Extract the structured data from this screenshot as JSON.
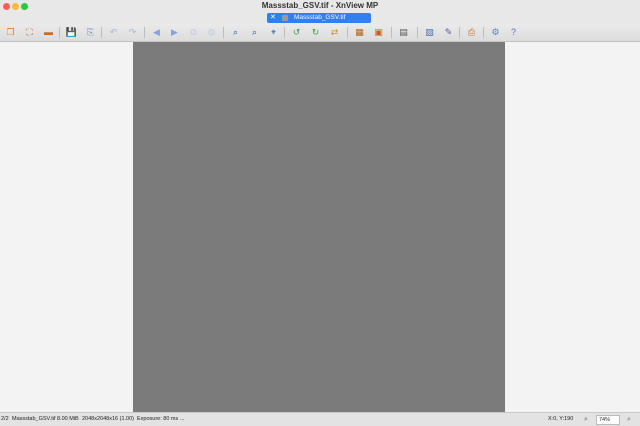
{
  "window": {
    "title": "Massstab_GSV.tif - XnView MP"
  },
  "tab": {
    "label": "Massstab_GSV.tif",
    "close": "✕"
  },
  "toolbar": {
    "buttons": [
      {
        "name": "browser-icon",
        "glyph": "❐",
        "color": "#d08a1e"
      },
      {
        "name": "fullscreen-icon",
        "glyph": "⛶",
        "color": "#d03a1e"
      },
      {
        "name": "slideshow-icon",
        "glyph": "▬",
        "color": "#d06a1e"
      },
      {
        "name": "save-icon",
        "glyph": "💾",
        "color": "#3a6fc0"
      },
      {
        "name": "save-as-icon",
        "glyph": "⎘",
        "color": "#7090b0"
      },
      {
        "name": "undo-icon",
        "glyph": "↶",
        "color": "#a9b3c4"
      },
      {
        "name": "redo-icon",
        "glyph": "↷",
        "color": "#a9b3c4"
      },
      {
        "name": "previous-icon",
        "glyph": "◀",
        "color": "#8aa2d8"
      },
      {
        "name": "next-icon",
        "glyph": "▶",
        "color": "#8aa2d8"
      },
      {
        "name": "first-icon",
        "glyph": "⊙",
        "color": "#b6c1d4"
      },
      {
        "name": "last-icon",
        "glyph": "⊙",
        "color": "#b6c1d4"
      },
      {
        "name": "zoom-in-icon",
        "glyph": "⌕",
        "color": "#2d56a8"
      },
      {
        "name": "zoom-out-icon",
        "glyph": "⌕",
        "color": "#2d56a8"
      },
      {
        "name": "zoom-fit-icon",
        "glyph": "⌖",
        "color": "#2d56a8"
      },
      {
        "name": "rotate-left-icon",
        "glyph": "↺",
        "color": "#3aa043"
      },
      {
        "name": "rotate-right-icon",
        "glyph": "↻",
        "color": "#3aa043"
      },
      {
        "name": "flip-icon",
        "glyph": "⇄",
        "color": "#c79a1e"
      },
      {
        "name": "crop-icon",
        "glyph": "▦",
        "color": "#b5601a"
      },
      {
        "name": "filter-icon",
        "glyph": "▣",
        "color": "#d05a1e"
      },
      {
        "name": "view-options-icon",
        "glyph": "▤",
        "color": "#555"
      },
      {
        "name": "info-icon",
        "glyph": "▨",
        "color": "#4a6fb0"
      },
      {
        "name": "edit-icon",
        "glyph": "✎",
        "color": "#6a4fb0"
      },
      {
        "name": "print-icon",
        "glyph": "⎙",
        "color": "#c06a1e"
      },
      {
        "name": "settings-icon",
        "glyph": "⚙",
        "color": "#5a7ab8"
      },
      {
        "name": "help-icon",
        "glyph": "?",
        "color": "#5a6fc8"
      }
    ]
  },
  "statusbar": {
    "index": "2/2",
    "filename": "Massstab_GSV.tif",
    "filesize": "8.00 MiB",
    "dimensions": "2048x2048x16 (1.00)",
    "exposure": "Exposure: 80 ms ...",
    "coords": "X:0, Y:190",
    "zoom": "74%"
  }
}
